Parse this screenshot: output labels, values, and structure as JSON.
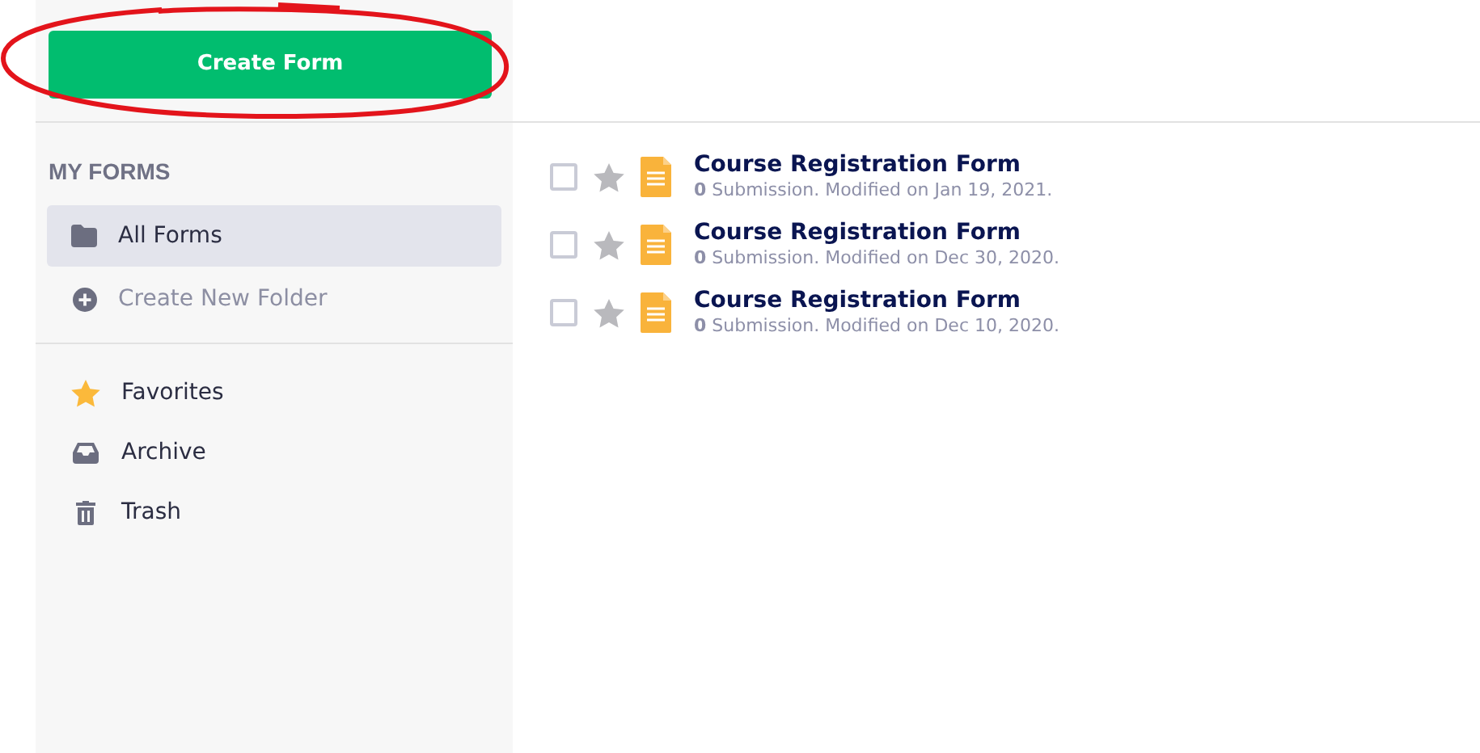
{
  "create_button": {
    "label": "Create Form"
  },
  "sidebar": {
    "heading": "MY FORMS",
    "folders": [
      {
        "label": "All Forms",
        "kind": "folder",
        "selected": true
      },
      {
        "label": "Create New Folder",
        "kind": "action",
        "selected": false
      }
    ],
    "sections": [
      {
        "label": "Favorites",
        "selected": false
      },
      {
        "label": "Archive",
        "selected": false
      },
      {
        "label": "Trash",
        "selected": false
      }
    ]
  },
  "forms": [
    {
      "title": "Course Registration Form",
      "subtitle": "**0** Submission. Modified on Jan 19, 2021.",
      "checked": false,
      "starred": false
    },
    {
      "title": "Course Registration Form",
      "subtitle": "**0** Submission. Modified on Dec 30, 2020.",
      "checked": false,
      "starred": false
    },
    {
      "title": "Course Registration Form",
      "subtitle": "**0** Submission. Modified on Dec 10, 2020.",
      "checked": false,
      "starred": false
    }
  ]
}
